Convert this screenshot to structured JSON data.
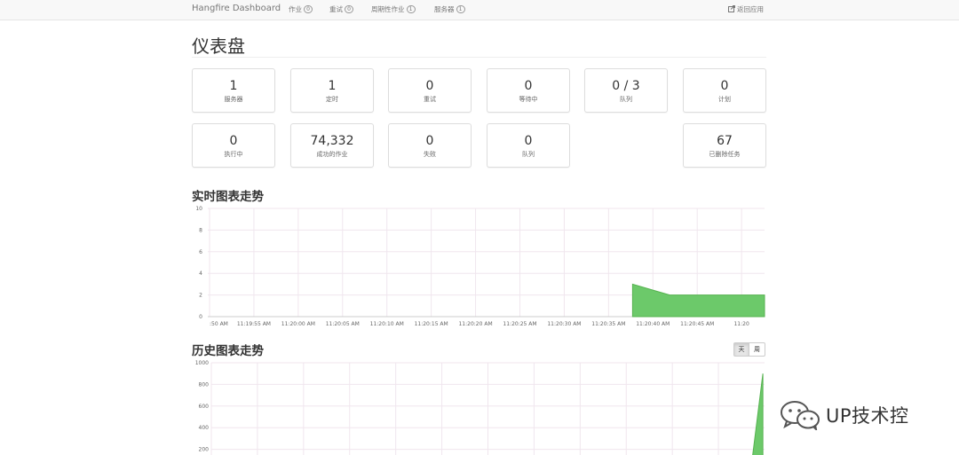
{
  "navbar": {
    "brand": "Hangfire Dashboard",
    "items": [
      {
        "label": "作业",
        "badge": "0"
      },
      {
        "label": "重试",
        "badge": "0"
      },
      {
        "label": "周期性作业",
        "badge": "1"
      },
      {
        "label": "服务器",
        "badge": "1"
      }
    ],
    "back_link": "返回应用"
  },
  "page": {
    "title": "仪表盘"
  },
  "metrics": [
    {
      "value": "1",
      "label": "服务器"
    },
    {
      "value": "1",
      "label": "定时"
    },
    {
      "value": "0",
      "label": "重试"
    },
    {
      "value": "0",
      "label": "等待中"
    },
    {
      "value": "0 / 3",
      "label": "队列"
    },
    {
      "value": "0",
      "label": "计划"
    },
    {
      "value": "0",
      "label": "执行中"
    },
    {
      "value": "74,332",
      "label": "成功的作业"
    },
    {
      "value": "0",
      "label": "失败"
    },
    {
      "value": "0",
      "label": "队列"
    },
    {
      "value": "67",
      "label": "已删除任务"
    }
  ],
  "realtime": {
    "title": "实时图表走势"
  },
  "history": {
    "title": "历史图表走势",
    "periods": [
      "天",
      "周"
    ],
    "active_period": "天"
  },
  "watermark": {
    "text": "UP技术控"
  },
  "colors": {
    "area_fill": "#6cc96a",
    "area_stroke": "#55b24f",
    "grid": "#f0e6ee"
  },
  "chart_data": [
    {
      "type": "area",
      "title": "实时图表走势",
      "x": [
        ":50 AM",
        "11:19:55 AM",
        "11:20:00 AM",
        "11:20:05 AM",
        "11:20:10 AM",
        "11:20:15 AM",
        "11:20:20 AM",
        "11:20:25 AM",
        "11:20:30 AM",
        "11:20:35 AM",
        "11:20:40 AM",
        "11:20:45 AM",
        "11:20"
      ],
      "y_ticks": [
        0,
        2,
        4,
        6,
        8,
        10
      ],
      "ylim": [
        0,
        10
      ],
      "series": [
        {
          "points": [
            [
              20.6,
              0
            ],
            [
              20.6,
              3
            ],
            [
              22.4,
              2
            ],
            [
              27,
              2
            ],
            [
              27,
              0
            ]
          ]
        }
      ],
      "x_domain": [
        0,
        27
      ],
      "tick_positions": [
        0,
        2.15,
        4.3,
        6.45,
        8.6,
        10.75,
        12.9,
        15.05,
        17.2,
        19.35,
        21.5,
        23.65,
        25.8
      ]
    },
    {
      "type": "area",
      "title": "历史图表走势",
      "y_ticks": [
        200,
        400,
        600,
        800,
        1000
      ],
      "ylim": [
        0,
        1000
      ],
      "series": [
        {
          "points": [
            [
              0.975,
              0
            ],
            [
              0.997,
              900
            ],
            [
              0.997,
              0
            ]
          ]
        }
      ]
    }
  ]
}
